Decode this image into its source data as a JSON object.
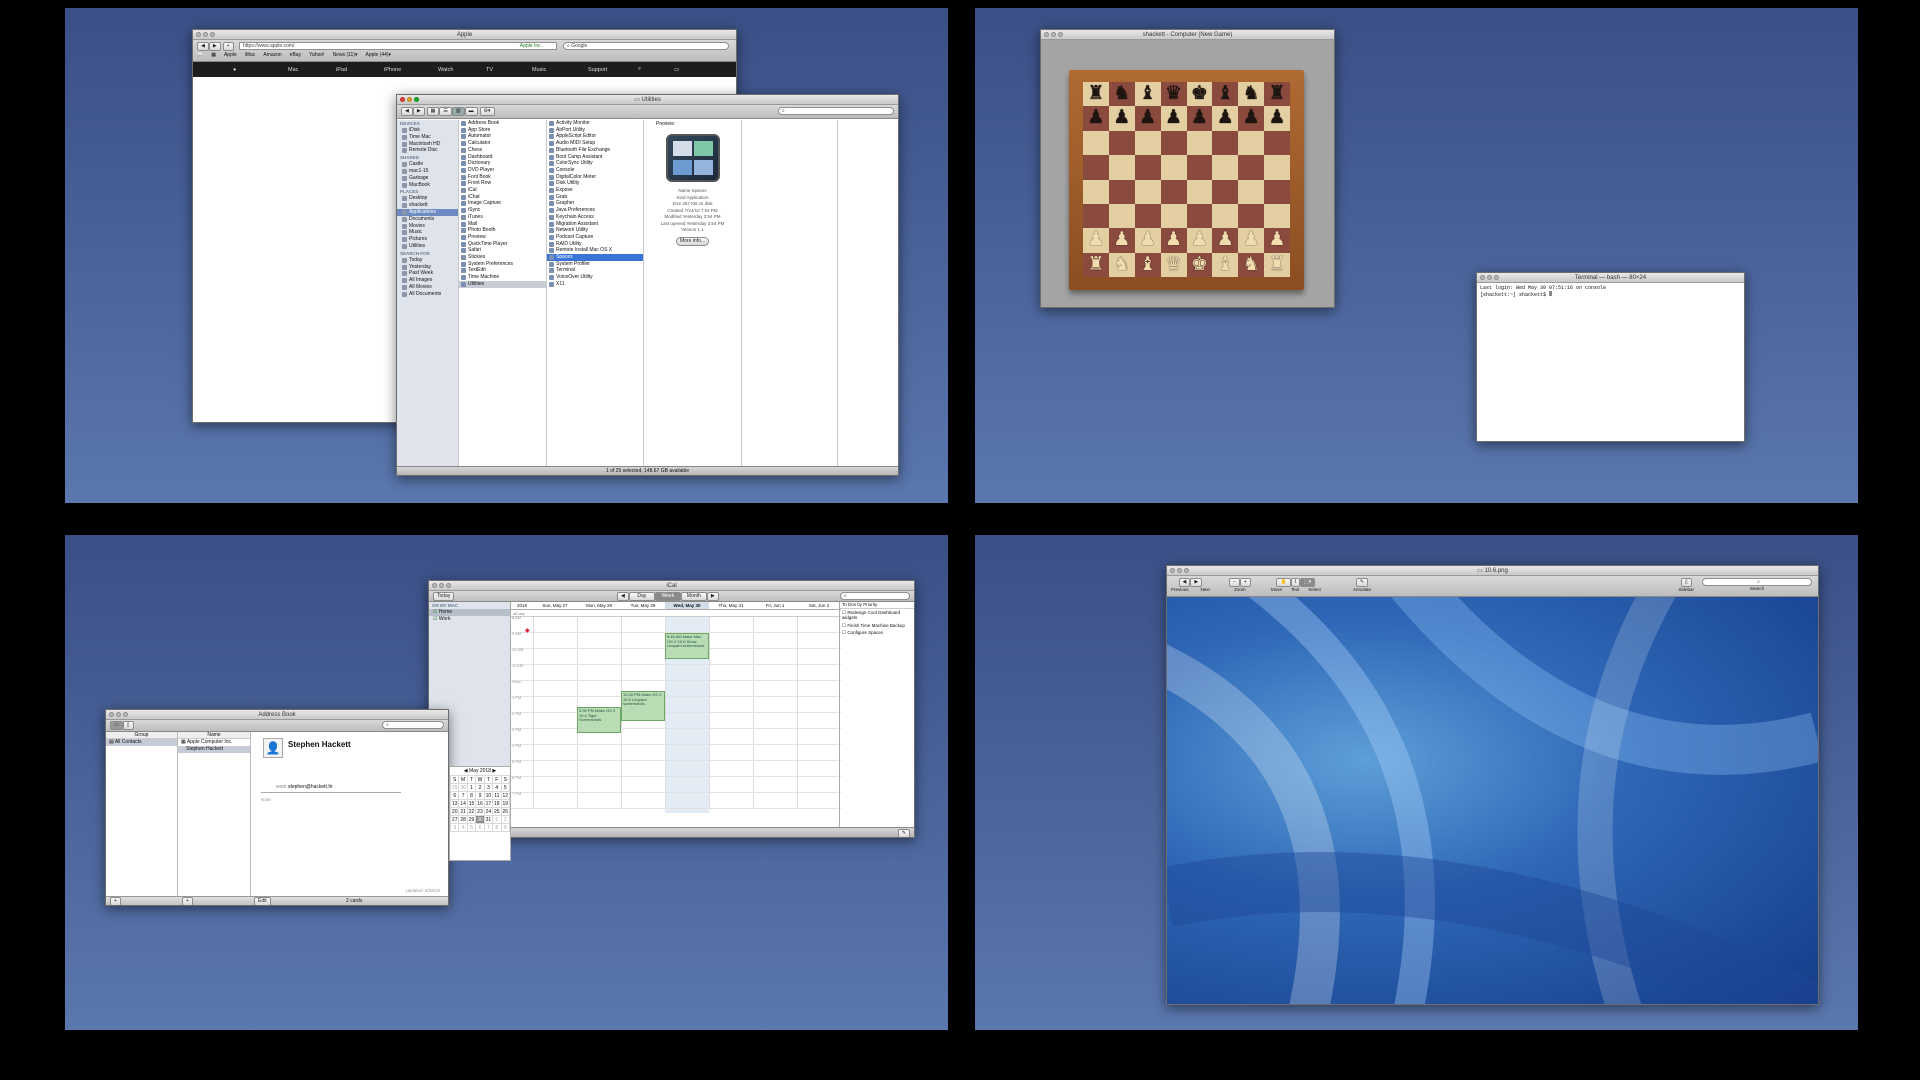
{
  "safari": {
    "title": "Apple",
    "url": "https://www.apple.com/",
    "site_badge": "Apple Inc.",
    "search_placeholder": "Google",
    "bookmarks": [
      "Apple",
      "iMac",
      "Amazon",
      "eBay",
      "Yahoo!",
      "News (11)▾",
      "Apple (44)▾"
    ],
    "nav": [
      "Mac",
      "iPad",
      "iPhone",
      "Watch",
      "TV",
      "Music",
      "Support"
    ]
  },
  "finder": {
    "title": "Utilities",
    "sidebar": [
      {
        "header": "DEVICES",
        "items": [
          "iDisk",
          "Time Mac",
          "Macintosh HD",
          "Remote Disc"
        ]
      },
      {
        "header": "SHARED",
        "items": [
          "Castle",
          "mac1-15",
          "Garbage",
          "MacBook"
        ]
      },
      {
        "header": "PLACES",
        "items": [
          "Desktop",
          "shackett",
          "Applications",
          "Documents",
          "Movies",
          "Music",
          "Pictures",
          "Utilities"
        ]
      },
      {
        "header": "SEARCH FOR",
        "items": [
          "Today",
          "Yesterday",
          "Past Week",
          "All Images",
          "All Movies",
          "All Documents"
        ]
      }
    ],
    "apps": [
      "Address Book",
      "App Store",
      "Automator",
      "Calculator",
      "Chess",
      "Dashboard",
      "Dictionary",
      "DVD Player",
      "Font Book",
      "Front Row",
      "iCal",
      "iChat",
      "Image Capture",
      "iSync",
      "iTunes",
      "Mail",
      "Photo Booth",
      "Preview",
      "QuickTime Player",
      "Safari",
      "Stickies",
      "System Preferences",
      "TextEdit",
      "Time Machine",
      "Utilities"
    ],
    "utilities": [
      "Activity Monitor",
      "AirPort Utility",
      "AppleScript Editor",
      "Audio MIDI Setup",
      "Bluetooth File Exchange",
      "Boot Camp Assistant",
      "ColorSync Utility",
      "Console",
      "DigitalColor Meter",
      "Disk Utility",
      "Expose",
      "Grab",
      "Grapher",
      "Java Preferences",
      "Keychain Access",
      "Migration Assistant",
      "Network Utility",
      "Podcast Capture",
      "RAID Utility",
      "Remote Install Mac OS X",
      "Spaces",
      "System Profiler",
      "Terminal",
      "VoiceOver Utility",
      "X11"
    ],
    "preview_header": "Preview:",
    "info": [
      "Name Spaces",
      "Kind Application",
      "Size 267 KB on disk",
      "Created 7/24/10 7:54 PM",
      "Modified Yesterday 3:54 PM",
      "Last opened Yesterday 3:54 PM",
      "Version 1.1"
    ],
    "more_info": "More info...",
    "status": "1 of 25 selected, 148.67 GB available"
  },
  "chess": {
    "title": "shackett - Computer (New Game)"
  },
  "terminal": {
    "title": "Terminal — bash — 80×24",
    "lines": [
      "Last login: Wed May 30 07:51:16 on console",
      "[shackett:~] shackett$ "
    ]
  },
  "ical": {
    "title": "iCal",
    "today": "Today",
    "views": [
      "Day",
      "Week",
      "Month"
    ],
    "sidebar_header": "ON MY MAC",
    "calendars": [
      "Home",
      "Work"
    ],
    "day_headers": [
      "Sun, May 27",
      "Mon, May 28",
      "Tue, May 29",
      "Wed, May 30",
      "Thu, May 31",
      "Fri, Jun 1",
      "Sat, Jun 2"
    ],
    "allday": "all-day",
    "year": "2018",
    "times": [
      "8 AM",
      "9 AM",
      "10 AM",
      "11 AM",
      "Noon",
      "1 PM",
      "2 PM",
      "3 PM",
      "4 PM",
      "5 PM",
      "6 PM",
      "7 PM"
    ],
    "events": [
      {
        "day": 3,
        "text": "9:45 AM Make Mac OS X 10.6 Snow Leopard screenshots"
      },
      {
        "day": 2,
        "text": "12:30 PM Make OS X 10.5 Leopard screenshots"
      },
      {
        "day": 1,
        "text": "2:00 PM Make OS X 10.4 Tiger Screenshots"
      }
    ],
    "todo_header": "To Dos by Priority",
    "todos": [
      "Redesign Cool Dashboard widgets",
      "Finish Time Machine Backup",
      "Configure Spaces"
    ],
    "mini_month": "May 2018",
    "mini_days": [
      "S",
      "M",
      "T",
      "W",
      "T",
      "F",
      "S"
    ],
    "mini_weeks": [
      [
        "29",
        "30",
        "1",
        "2",
        "3",
        "4",
        "5"
      ],
      [
        "6",
        "7",
        "8",
        "9",
        "10",
        "11",
        "12"
      ],
      [
        "13",
        "14",
        "15",
        "16",
        "17",
        "18",
        "19"
      ],
      [
        "20",
        "21",
        "22",
        "23",
        "24",
        "25",
        "26"
      ],
      [
        "27",
        "28",
        "29",
        "30",
        "31",
        "1",
        "2"
      ],
      [
        "3",
        "4",
        "5",
        "6",
        "7",
        "8",
        "9"
      ]
    ]
  },
  "addressbook": {
    "title": "Address Book",
    "group_header": "Group",
    "name_header": "Name",
    "groups": [
      "All Contacts"
    ],
    "names": [
      "Apple Computer Inc.",
      "Stephen Hackett"
    ],
    "contact_name": "Stephen Hackett",
    "email_label": "work",
    "email": "stephen@hackett.ltr",
    "note_label": "Note:",
    "edit": "Edit",
    "count": "2 cards",
    "updated": "Updated: 5/29/18"
  },
  "preview": {
    "title": "10.6.png",
    "toolbar": [
      "Previous",
      "Next",
      "Zoom",
      "Move",
      "Text",
      "Select",
      "Annotate",
      "Sidebar",
      "Search"
    ]
  }
}
